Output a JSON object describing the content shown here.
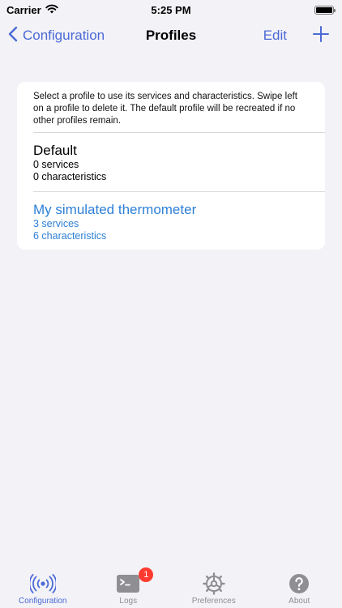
{
  "status_bar": {
    "carrier": "Carrier",
    "time": "5:25 PM"
  },
  "nav": {
    "back_label": "Configuration",
    "title": "Profiles",
    "edit_label": "Edit",
    "add_icon": "plus-icon"
  },
  "card": {
    "note": "Select a profile to use its services and characteristics. Swipe left on a profile to delete it. The default profile will be recreated if no other profiles remain.",
    "profiles": [
      {
        "name": "Default",
        "services": "0 services",
        "characteristics": "0 characteristics",
        "selected": false
      },
      {
        "name": "My simulated thermometer",
        "services": "3 services",
        "characteristics": "6 characteristics",
        "selected": true
      }
    ]
  },
  "tabs": [
    {
      "label": "Configuration",
      "icon": "broadcast-icon",
      "active": true
    },
    {
      "label": "Logs",
      "icon": "terminal-icon",
      "badge": "1",
      "active": false
    },
    {
      "label": "Preferences",
      "icon": "gear-icon",
      "active": false
    },
    {
      "label": "About",
      "icon": "question-icon",
      "active": false
    }
  ],
  "colors": {
    "accent": "#4c6ad6",
    "selected_profile": "#2d7fd6",
    "background": "#f2f2f7",
    "badge": "#ff3b30"
  }
}
